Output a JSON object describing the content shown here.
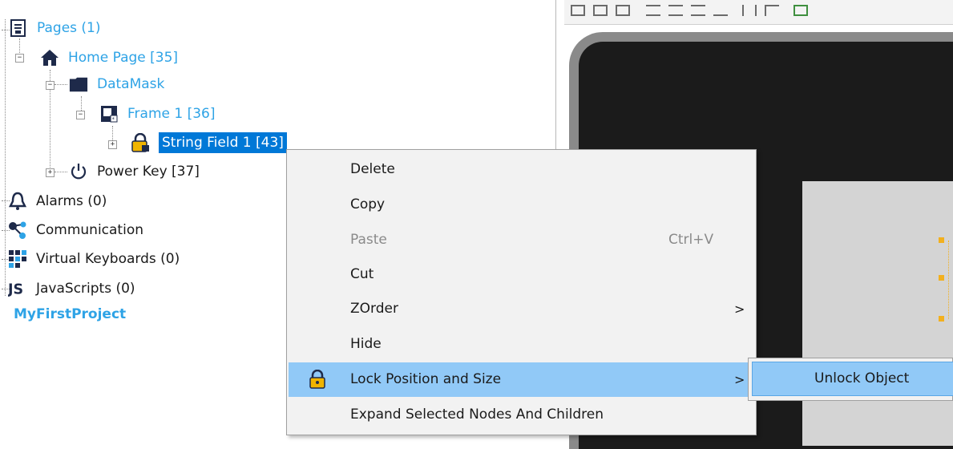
{
  "tree": {
    "pages": {
      "label": "Pages (1)",
      "icon": "pages-icon"
    },
    "home_page": {
      "label": "Home Page [35]",
      "icon": "home-icon"
    },
    "datamask": {
      "label": "DataMask",
      "icon": "folder-icon"
    },
    "frame": {
      "label": "Frame 1 [36]",
      "icon": "frame-icon"
    },
    "string_field": {
      "label": "String Field 1 [43]",
      "icon": "lock-icon"
    },
    "power_key": {
      "label": "Power Key [37]",
      "icon": "power-icon"
    },
    "alarms": {
      "label": "Alarms (0)",
      "icon": "alarm-bell-icon"
    },
    "communication": {
      "label": "Communication",
      "icon": "communication-icon"
    },
    "virtual_keyboards": {
      "label": "Virtual Keyboards (0)",
      "icon": "keyboard-icon"
    },
    "javascripts": {
      "label": "JavaScripts (0)",
      "icon": "javascript-icon"
    },
    "project": {
      "label": "MyFirstProject"
    }
  },
  "context_menu": {
    "items": [
      {
        "label": "Delete"
      },
      {
        "label": "Copy"
      },
      {
        "label": "Paste",
        "shortcut": "Ctrl+V",
        "disabled": true
      },
      {
        "label": "Cut"
      },
      {
        "label": "ZOrder",
        "submenu": true
      },
      {
        "label": "Hide"
      },
      {
        "label": "Lock Position and Size",
        "icon": "lock-icon",
        "submenu": true,
        "highlighted": true
      },
      {
        "label": "Expand Selected Nodes And Children"
      }
    ],
    "submenu_arrow": ">"
  },
  "submenu": {
    "items": [
      {
        "label": "Unlock Object"
      }
    ]
  },
  "colors": {
    "tree_link": "#2ea3e6",
    "selection": "#0078d7",
    "menu_highlight": "#91c9f7",
    "device_bezel": "#8a8a8a",
    "device_body": "#1b1b1b",
    "handle": "#f2b01e"
  }
}
